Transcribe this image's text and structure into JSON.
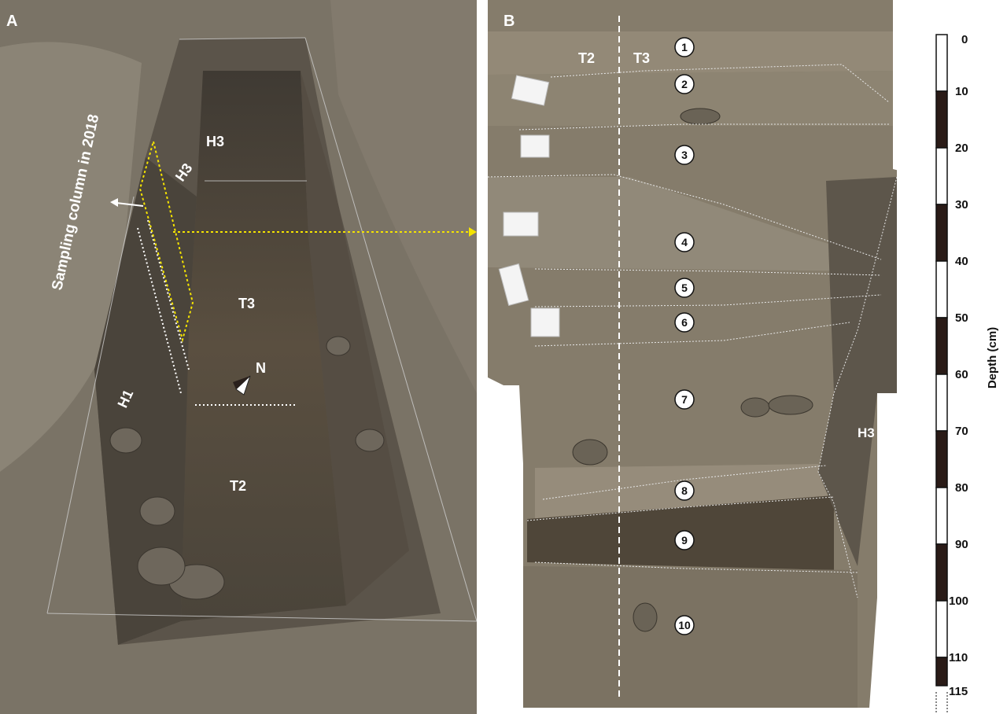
{
  "panel_a": {
    "label": "A",
    "annotations": {
      "sampling": "Sampling column in 2018",
      "h3_top": "H3",
      "h3_side": "H3",
      "t3": "T3",
      "north": "N",
      "h1": "H1",
      "t2": "T2"
    }
  },
  "panel_b": {
    "label": "B",
    "t2": "T2",
    "t3": "T3",
    "h3": "H3",
    "layers": [
      "1",
      "2",
      "3",
      "4",
      "5",
      "6",
      "7",
      "8",
      "9",
      "10"
    ]
  },
  "scale_bar": {
    "axis_label": "Depth (cm)",
    "ticks": [
      "0",
      "10",
      "20",
      "30",
      "40",
      "50",
      "60",
      "70",
      "80",
      "90",
      "100",
      "110",
      "115"
    ]
  },
  "colors": {
    "annotation": "#ffffff",
    "arrow": "#f5e400",
    "sediment": "#8a8170"
  }
}
